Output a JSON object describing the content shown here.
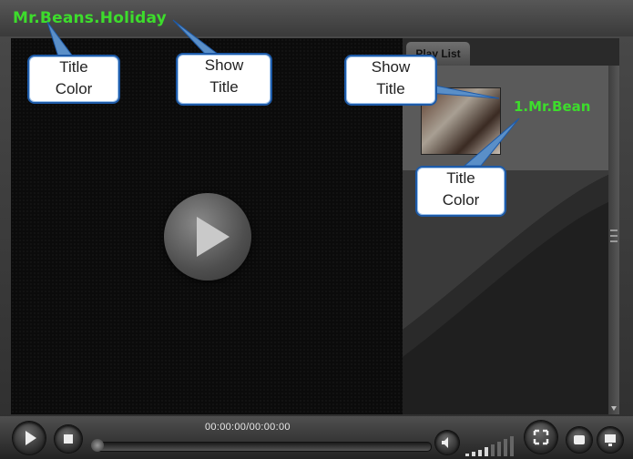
{
  "window": {
    "show_title": "Mr.Beans.Holiday"
  },
  "playlist": {
    "tab_label": "Play List",
    "items": [
      {
        "title": "1.Mr.Bean"
      }
    ]
  },
  "controls": {
    "time": "00:00:00/00:00:00"
  },
  "annotations": {
    "callout_1": [
      "Title",
      "Color"
    ],
    "callout_2": [
      "Show",
      "Title"
    ],
    "callout_3": [
      "Show",
      "Title"
    ],
    "callout_4": [
      "Title",
      "Color"
    ]
  },
  "colors": {
    "title_color": "#3ddc2c",
    "callout_border": "#1d5aa8"
  }
}
